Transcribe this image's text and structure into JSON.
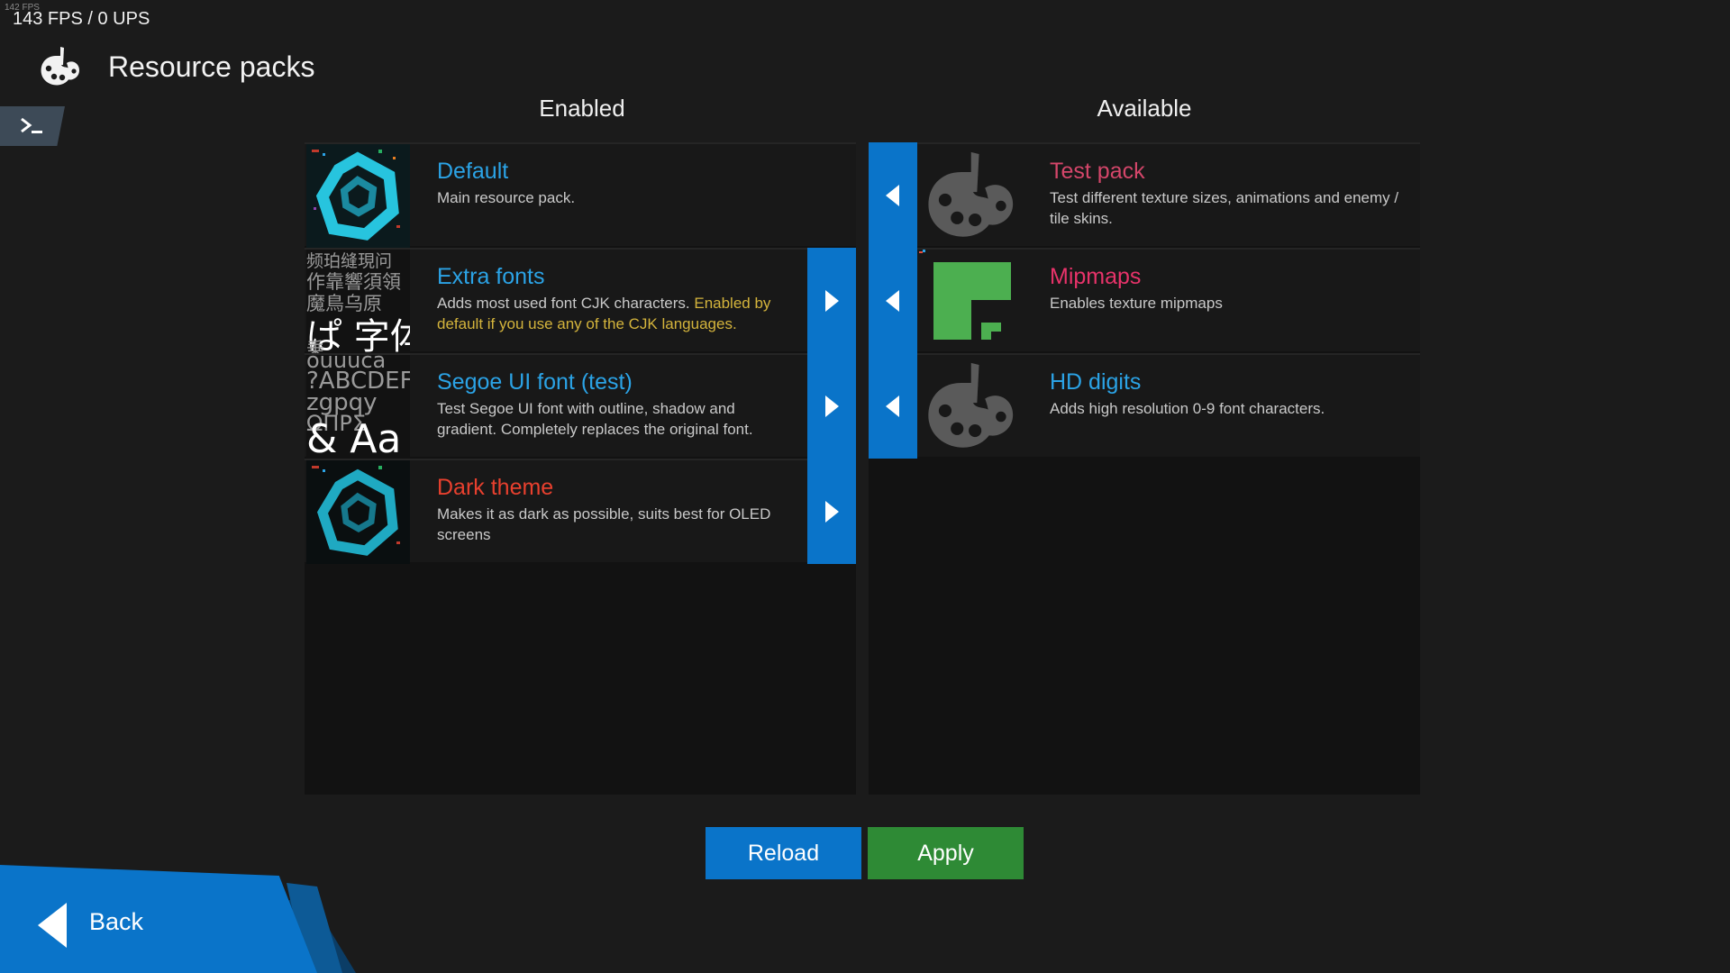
{
  "perf": {
    "small": "142 FPS",
    "main": "143 FPS / 0 UPS"
  },
  "header": {
    "title": "Resource packs",
    "icon": "palette-icon"
  },
  "columns": {
    "enabled": "Enabled",
    "available": "Available"
  },
  "enabled_packs": [
    {
      "name": "Default",
      "name_color": "#2ba3e6",
      "desc": "Main resource pack.",
      "desc_extra": "",
      "thumb": "logo-thumbnail"
    },
    {
      "name": "Extra fonts",
      "name_color": "#2ba3e6",
      "desc": "Adds most used font CJK characters. ",
      "desc_extra": "Enabled by default if you use any of the CJK languages.",
      "thumb": "cjk-glyphs-thumbnail"
    },
    {
      "name": "Segoe UI font (test)",
      "name_color": "#2ba3e6",
      "desc": "Test Segoe UI font with outline, shadow and gradient. Completely replaces the original font.",
      "desc_extra": "",
      "thumb": "font-sample-thumbnail"
    },
    {
      "name": "Dark theme",
      "name_color": "#e8402e",
      "desc": "Makes it as dark as possible, suits best for OLED screens",
      "desc_extra": "",
      "thumb": "logo-thumbnail"
    }
  ],
  "available_packs": [
    {
      "name": "Test pack",
      "name_color": "#d4466a",
      "desc": "Test different texture sizes, animations and enemy / tile skins.",
      "thumb": "palette-thumbnail"
    },
    {
      "name": "Mipmaps",
      "name_color": "#e8336a",
      "desc": "Enables texture mipmaps",
      "thumb": "mipmap-thumbnail"
    },
    {
      "name": "HD digits",
      "name_color": "#2ba3e6",
      "desc": "Adds high resolution 0-9 font characters.",
      "thumb": "palette-thumbnail"
    }
  ],
  "thumb_text": {
    "cjk_lines": [
      "频珀缝現问",
      "作靠響須領",
      "魔鳥乌原",
      "ぱ 字体",
      "乗 "
    ],
    "font_lines": [
      "ouuuca",
      "?ABCDEF",
      "zgpqy",
      "ΩΠΡΣ",
      "&  Aa"
    ]
  },
  "actions": {
    "reload": "Reload",
    "apply": "Apply"
  },
  "back": {
    "label": "Back"
  },
  "colors": {
    "accent": "#0a74c9",
    "apply": "#2e8a35",
    "highlight": "#d4b43c"
  }
}
